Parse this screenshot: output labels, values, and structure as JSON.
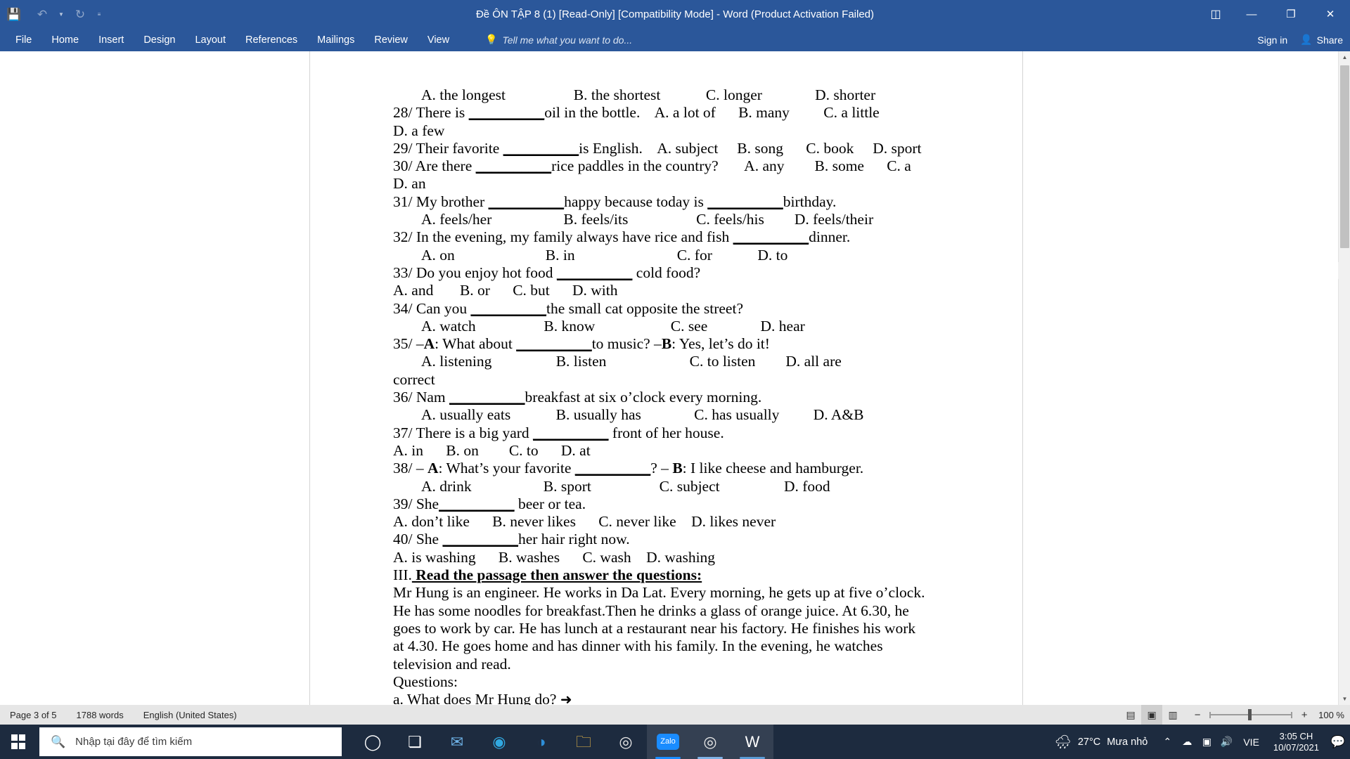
{
  "window": {
    "title": "Đề ÔN TẬP 8 (1) [Read-Only] [Compatibility Mode] - Word (Product Activation Failed)",
    "quick_access": {
      "save_icon": "save-icon",
      "undo_icon": "undo-icon",
      "redo_icon": "redo-icon",
      "customize_icon": "customize-quick-access-icon"
    },
    "controls": {
      "ribbon_display_options": "ribbon-display-options-icon",
      "minimize": "minimize-icon",
      "restore": "restore-icon",
      "close": "close-icon"
    }
  },
  "ribbon": {
    "tabs": [
      {
        "label": "File"
      },
      {
        "label": "Home"
      },
      {
        "label": "Insert"
      },
      {
        "label": "Design"
      },
      {
        "label": "Layout"
      },
      {
        "label": "References"
      },
      {
        "label": "Mailings"
      },
      {
        "label": "Review"
      },
      {
        "label": "View"
      }
    ],
    "tell_me": "Tell me what you want to do...",
    "sign_in": "Sign in",
    "share": "Share"
  },
  "document": {
    "lines": [
      {
        "indent": 40,
        "html": "A. the longest                  B. the shortest            C. longer              D. shorter"
      },
      {
        "indent": 0,
        "html": "28/ There is <u>__________</u>oil in the bottle.    A. a lot of      B. many         C. a little"
      },
      {
        "indent": 0,
        "html": "D. a few"
      },
      {
        "indent": 0,
        "html": "29/ Their favorite <u>__________</u>is English.    A. subject     B. song      C. book     D. sport"
      },
      {
        "indent": 0,
        "html": "30/ Are there <u>__________</u>rice paddles in the country?       A. any        B. some      C. a"
      },
      {
        "indent": 0,
        "html": "D. an"
      },
      {
        "indent": 0,
        "html": "31/ My brother <u>__________</u>happy because today is <u>__________</u>birthday."
      },
      {
        "indent": 40,
        "html": "A. feels/her                   B. feels/its                  C. feels/his        D. feels/their"
      },
      {
        "indent": 0,
        "html": "32/ In the evening, my family always have rice and fish <u>__________</u>dinner."
      },
      {
        "indent": 40,
        "html": "A. on                        B. in                           C. for            D. to"
      },
      {
        "indent": 0,
        "html": "33/ Do you enjoy hot food <u>__________</u> cold food?"
      },
      {
        "indent": 0,
        "html": "A. and       B. or      C. but      D. with"
      },
      {
        "indent": 0,
        "html": "34/ Can you <u>__________</u>the small cat opposite the street?"
      },
      {
        "indent": 40,
        "html": "A. watch                  B. know                    C. see              D. hear"
      },
      {
        "indent": 0,
        "html": "35/ –<b>A</b>: What about <u>__________</u>to music? –<b>B</b>: Yes, let’s do it!"
      },
      {
        "indent": 40,
        "html": "A. listening                 B. listen                      C. to listen        D. all are"
      },
      {
        "indent": 0,
        "html": "correct"
      },
      {
        "indent": 0,
        "html": "36/ Nam <u>__________</u>breakfast at six o’clock every morning."
      },
      {
        "indent": 40,
        "html": "A. usually eats            B. usually has              C. has usually         D. A&amp;B"
      },
      {
        "indent": 0,
        "html": "37/ There is a big yard <u>__________</u> front of her house."
      },
      {
        "indent": 0,
        "html": "A. in      B. on        C. to      D. at"
      },
      {
        "indent": 0,
        "html": "38/ – <b>A</b>: What’s your favorite <u>__________</u>? – <b>B</b>: I like cheese and hamburger."
      },
      {
        "indent": 40,
        "html": "A. drink                   B. sport                  C. subject                 D. food"
      },
      {
        "indent": 0,
        "html": "39/ She<u>__________</u> beer or tea."
      },
      {
        "indent": 0,
        "html": "A. don’t like      B. never likes      C. never like    D. likes never"
      },
      {
        "indent": 0,
        "html": "40/ She <u>__________</u>her hair right now."
      },
      {
        "indent": 0,
        "html": "A. is washing      B. washes      C. wash    D. washing"
      },
      {
        "indent": 0,
        "html": "III.<span class=\"hd3\"> Read the passage then answer the questions:</span>"
      },
      {
        "indent": 0,
        "html": "Mr Hung is an engineer. He works in Da Lat. Every morning, he gets up at five o’clock."
      },
      {
        "indent": 0,
        "html": "He has some noodles for breakfast.Then he drinks a glass of orange juice. At 6.30, he"
      },
      {
        "indent": 0,
        "html": "goes to work by car. He has lunch at a restaurant near his factory. He finishes his work"
      },
      {
        "indent": 0,
        "html": "at 4.30. He goes home and has dinner with his family. In the evening, he watches"
      },
      {
        "indent": 0,
        "html": "television and read."
      },
      {
        "indent": 0,
        "html": "Questions:"
      },
      {
        "indent": 0,
        "html": "a. What does Mr Hung do? <span class=\"arrow\">&#10140;</span>"
      }
    ]
  },
  "status_bar": {
    "page": "Page 3 of 5",
    "words": "1788 words",
    "language": "English (United States)",
    "views": [
      {
        "name": "read-mode-view",
        "glyph": "▤",
        "active": false
      },
      {
        "name": "print-layout-view",
        "glyph": "▣",
        "active": true
      },
      {
        "name": "web-layout-view",
        "glyph": "▥",
        "active": false
      }
    ],
    "zoom_out": "−",
    "zoom_in": "+",
    "zoom_level": "100 %"
  },
  "taskbar": {
    "start": "start-button",
    "search_placeholder": "Nhập tại đây để tìm kiếm",
    "icons": [
      {
        "name": "cortana-icon",
        "glyph": "◯",
        "color": "#ffffff",
        "underline": "",
        "open": false
      },
      {
        "name": "task-view-icon",
        "glyph": "❏",
        "color": "#ffffff",
        "underline": "",
        "open": false
      },
      {
        "name": "mail-icon",
        "glyph": "✉",
        "color": "#6fb3e8",
        "underline": "",
        "open": false
      },
      {
        "name": "microsoft-edge-icon",
        "glyph": "◉",
        "color": "#31a8e0",
        "underline": "",
        "open": false
      },
      {
        "name": "browser-icon",
        "glyph": "◑",
        "color": "#2e8fd8",
        "underline": "",
        "open": false
      },
      {
        "name": "file-explorer-icon",
        "glyph": "🗀",
        "color": "#f5c04a",
        "underline": "",
        "open": false
      },
      {
        "name": "google-chrome-icon",
        "glyph": "◎",
        "color": "#e8e8e8",
        "underline": "",
        "open": false
      },
      {
        "name": "zalo-icon",
        "glyph": "Zalo",
        "color": "#ffffff",
        "underline": "#1a8cff",
        "open": true
      },
      {
        "name": "google-chrome-window-icon",
        "glyph": "◎",
        "color": "#e8e8e8",
        "underline": "#7fb2e5",
        "open": true
      },
      {
        "name": "microsoft-word-icon",
        "glyph": "W",
        "color": "#ffffff",
        "underline": "#5b9bd5",
        "open": true
      }
    ],
    "weather": {
      "icon": "rain-cloud-icon",
      "temperature": "27°C",
      "condition": "Mưa nhỏ"
    },
    "tray": [
      {
        "name": "show-hidden-icons",
        "glyph": "⌃"
      },
      {
        "name": "onedrive-icon",
        "glyph": "☁"
      },
      {
        "name": "unikey-icon",
        "glyph": "▣"
      },
      {
        "name": "volume-icon",
        "glyph": "🔊"
      }
    ],
    "language": "VIE",
    "clock_time": "3:05 CH",
    "clock_date": "10/07/2021",
    "notification": "action-center-icon"
  }
}
